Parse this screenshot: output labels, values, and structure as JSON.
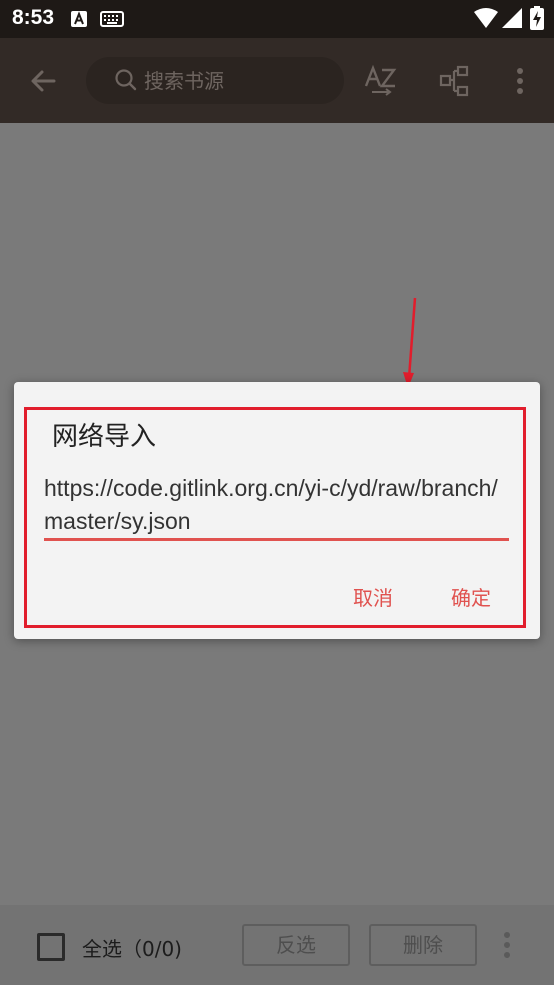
{
  "status_bar": {
    "time": "8:53"
  },
  "toolbar": {
    "search_placeholder": "搜索书源",
    "icons": [
      "back-arrow-icon",
      "search-icon",
      "sort-az-icon",
      "group-icon",
      "more-vert-icon"
    ]
  },
  "dialog": {
    "title": "网络导入",
    "url_value": "https://code.gitlink.org.cn/yi-c/yd/raw/branch/master/sy.json",
    "cancel_label": "取消",
    "ok_label": "确定"
  },
  "bottom_bar": {
    "select_all_label": "全选（0/0)",
    "invert_label": "反选",
    "delete_label": "删除"
  },
  "colors": {
    "accent": "#e0524f",
    "annotation": "#e11d2c",
    "toolbar": "#322a26"
  }
}
